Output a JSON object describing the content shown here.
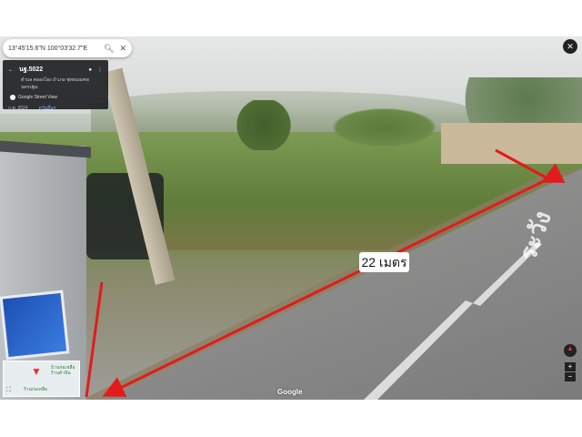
{
  "search": {
    "coords": "13°45'15.6\"N 100°03'32.7\"E",
    "search_icon": "search-icon",
    "close_icon": "close-icon"
  },
  "info_panel": {
    "road_name": "นฐ.5022",
    "address": "ตำบล คลองโยง อำเภอ พุทธมณฑล นครปฐม",
    "source": "Google Street View",
    "date": "ก.พ. 2024",
    "more_dates": "ดูวันอื่นๆ"
  },
  "measurement": {
    "label": "22 เมตร",
    "color": "#e21b1b"
  },
  "minimap": {
    "place": "บ้านก่อเหลือ ร้านค้าบิน",
    "name": "ร้านก่อเหลือ"
  },
  "controls": {
    "zoom_in": "+",
    "zoom_out": "−"
  },
  "brand": "Google",
  "road_paint": "ระวัง"
}
